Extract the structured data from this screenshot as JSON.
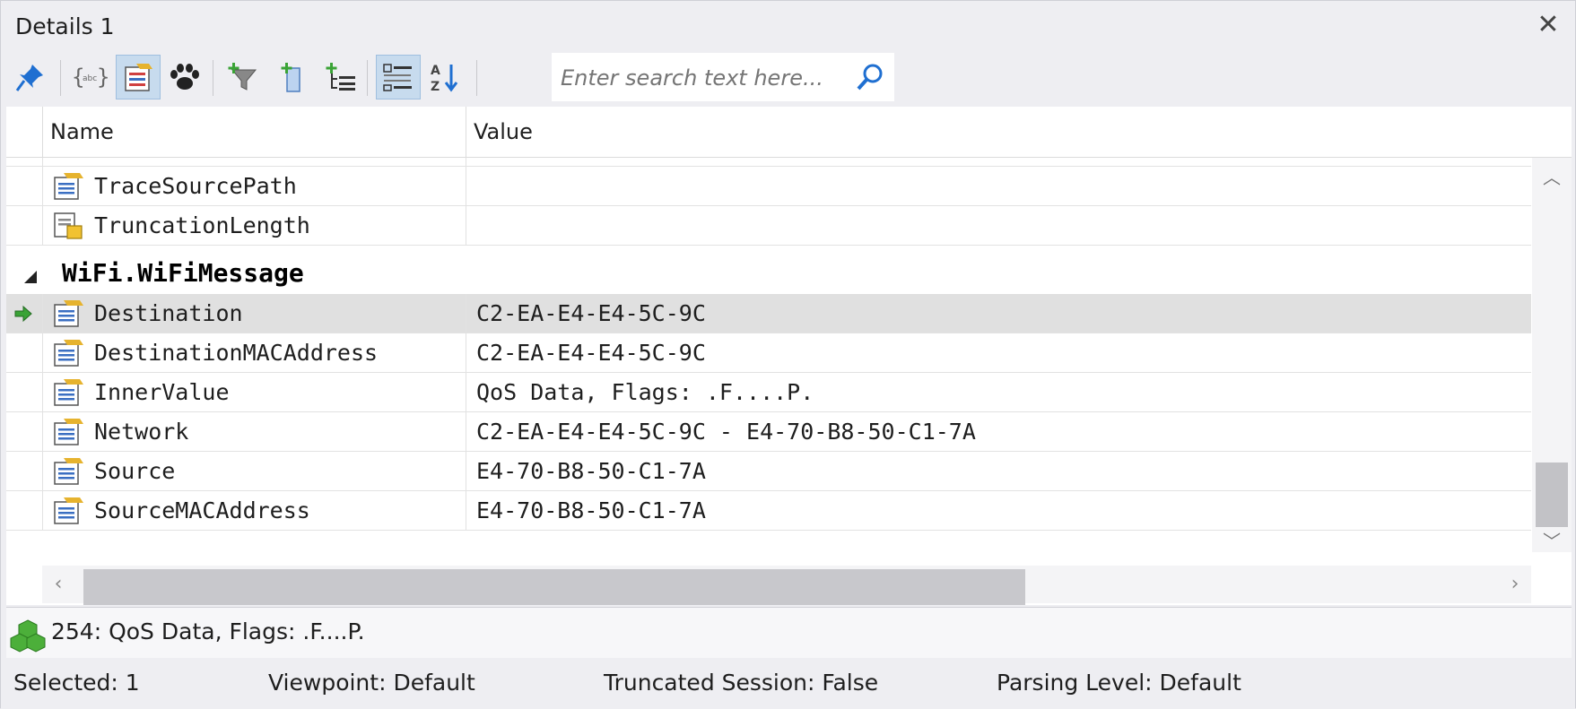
{
  "window": {
    "title": "Details 1"
  },
  "toolbar": {
    "search": {
      "placeholder": "Enter search text here..."
    }
  },
  "grid": {
    "columns": [
      "Name",
      "Value"
    ],
    "rows_top": [
      {
        "name": "TraceSourcePath",
        "value": ""
      },
      {
        "name": "TruncationLength",
        "value": ""
      }
    ],
    "group": {
      "name": "WiFi.WiFiMessage"
    },
    "rows_group": [
      {
        "name": "Destination",
        "value": "C2-EA-E4-E4-5C-9C"
      },
      {
        "name": "DestinationMACAddress",
        "value": "C2-EA-E4-E4-5C-9C"
      },
      {
        "name": "InnerValue",
        "value": "QoS Data, Flags: .F....P."
      },
      {
        "name": "Network",
        "value": "C2-EA-E4-E4-5C-9C - E4-70-B8-50-C1-7A"
      },
      {
        "name": "Source",
        "value": "E4-70-B8-50-C1-7A"
      },
      {
        "name": "SourceMACAddress",
        "value": "E4-70-B8-50-C1-7A"
      }
    ]
  },
  "infobar": {
    "text": "254:  QoS Data, Flags: .F....P."
  },
  "status": {
    "selected": "Selected: 1",
    "viewpoint": "Viewpoint: Default",
    "truncated": "Truncated Session: False",
    "parsing": "Parsing Level: Default"
  },
  "colors": {
    "accent": "#1f6fd1",
    "selected_row": "#e0e0e0",
    "toolbar_active": "#c7dbee"
  }
}
